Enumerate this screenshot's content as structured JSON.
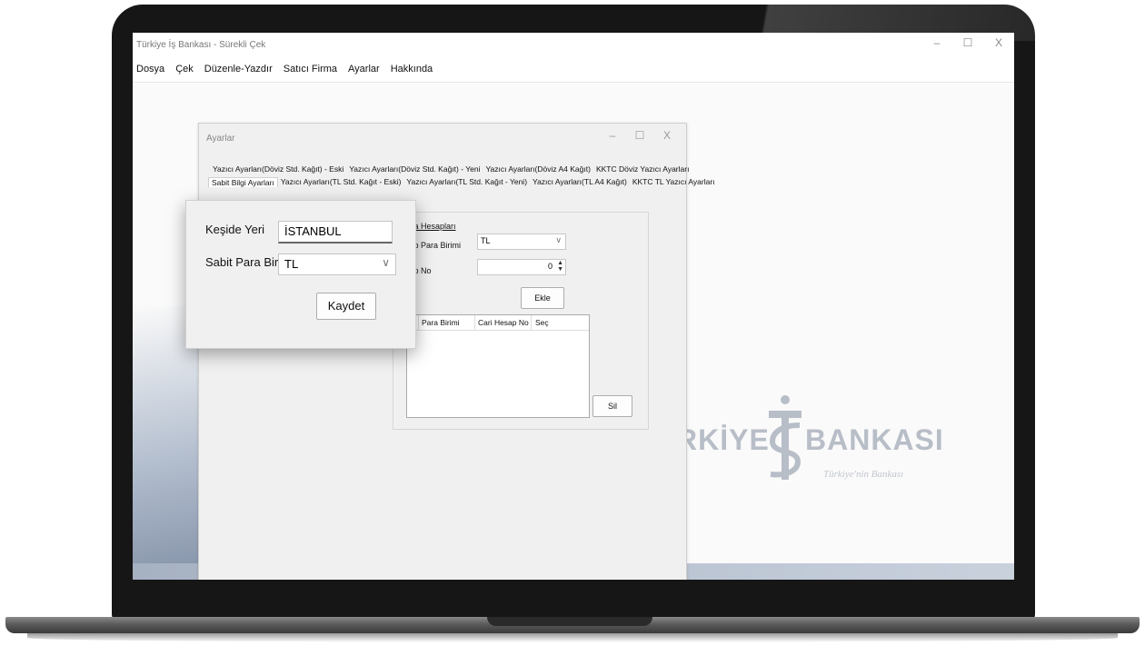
{
  "window": {
    "title": "Türkiye İş Bankası - Sürekli Çek",
    "controls": [
      "–",
      "☐",
      "X"
    ]
  },
  "menu": [
    "Dosya",
    "Çek",
    "Düzenle-Yazdır",
    "Satıcı Firma",
    "Ayarlar",
    "Hakkında"
  ],
  "branding": {
    "text_left": "RKİYE",
    "text_right": "BANKASI",
    "tagline": "Türkiye'nin Bankası"
  },
  "settings": {
    "title": "Ayarlar",
    "controls": [
      "–",
      "☐",
      "X"
    ],
    "tabs_row1": [
      "Yazıcı Ayarları(Döviz Std. Kağıt) - Eski",
      "Yazıcı Ayarları(Döviz Std. Kağıt) - Yeni",
      "Yazıcı Ayarları(Döviz A4 Kağıt)",
      "KKTC Döviz Yazıcı Ayarları"
    ],
    "tabs_row2": [
      "Sabit Bilgi Ayarları",
      "Yazıcı Ayarları(TL Std. Kağıt - Eski)",
      "Yazıcı Ayarları(TL Std. Kağıt - Yeni)",
      "Yazıcı Ayarları(TL A4 Kağıt)",
      "KKTC TL Yazıcı Ayarları"
    ],
    "bank": {
      "section_label": "anka Hesapları",
      "currency_label": "esap Para Birimi",
      "currency_value": "TL",
      "account_label": "esap No",
      "account_value": "0",
      "add_button": "Ekle",
      "delete_button": "Sil",
      "columns": [
        "Para Birimi",
        "Cari Hesap No",
        "Seç"
      ]
    }
  },
  "popup": {
    "place_label": "Keşide Yeri",
    "place_value": "İSTANBUL",
    "currency_label": "Sabit Para Birimi",
    "currency_value": "TL",
    "save_button": "Kaydet"
  }
}
